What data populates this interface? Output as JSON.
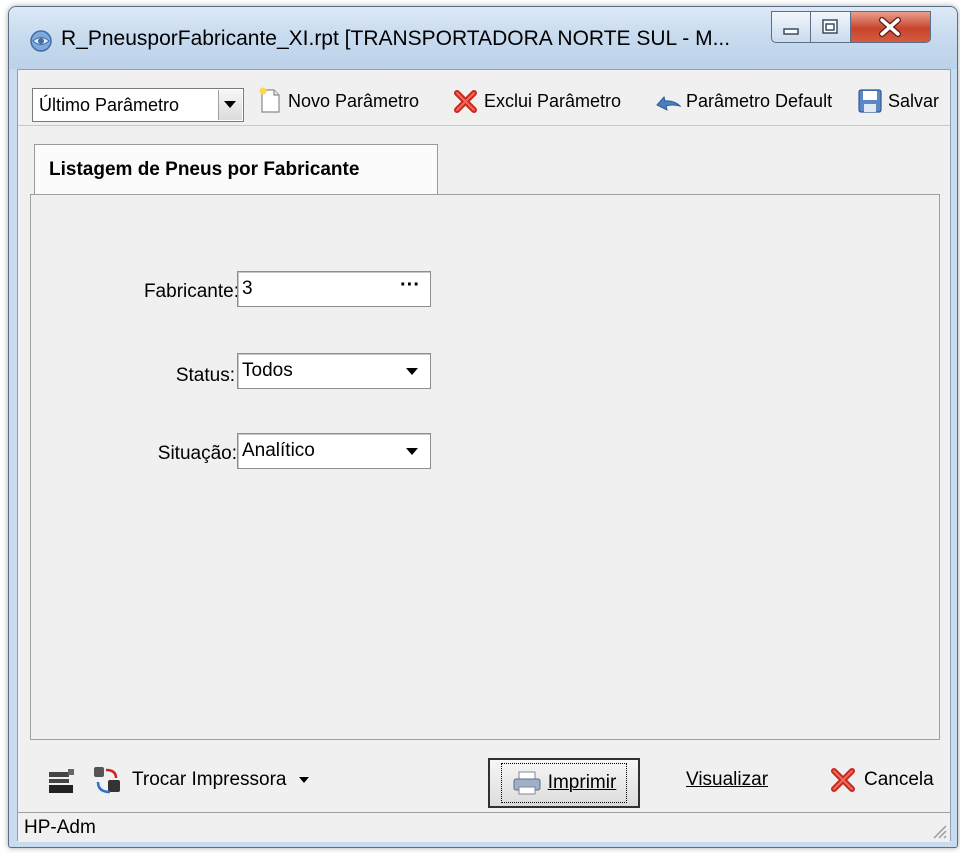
{
  "window": {
    "title": "R_PneusporFabricante_XI.rpt [TRANSPORTADORA NORTE SUL -  M...",
    "icon": "report-app-icon"
  },
  "toolbar": {
    "param_select_value": "Último Parâmetro",
    "novo_label": "Novo Parâmetro",
    "exclui_label": "Exclui Parâmetro",
    "default_label": "Parâmetro Default",
    "salvar_label": "Salvar"
  },
  "tabs": [
    {
      "label": "Listagem de Pneus por Fabricante"
    }
  ],
  "form": {
    "fabricante": {
      "label": "Fabricante:",
      "value": "3"
    },
    "status": {
      "label": "Status:",
      "value": "Todos"
    },
    "situacao": {
      "label": "Situação:",
      "value": "Analítico"
    }
  },
  "bottom": {
    "trocar_label": "Trocar Impressora",
    "imprimir_label": "Imprimir",
    "visualizar_label": "Visualizar",
    "cancela_label": "Cancela"
  },
  "status_bar": {
    "text": "HP-Adm"
  },
  "colors": {
    "close_red": "#c8452c",
    "title_bg": "#c7daee",
    "panel_bg": "#f0f0f0"
  }
}
